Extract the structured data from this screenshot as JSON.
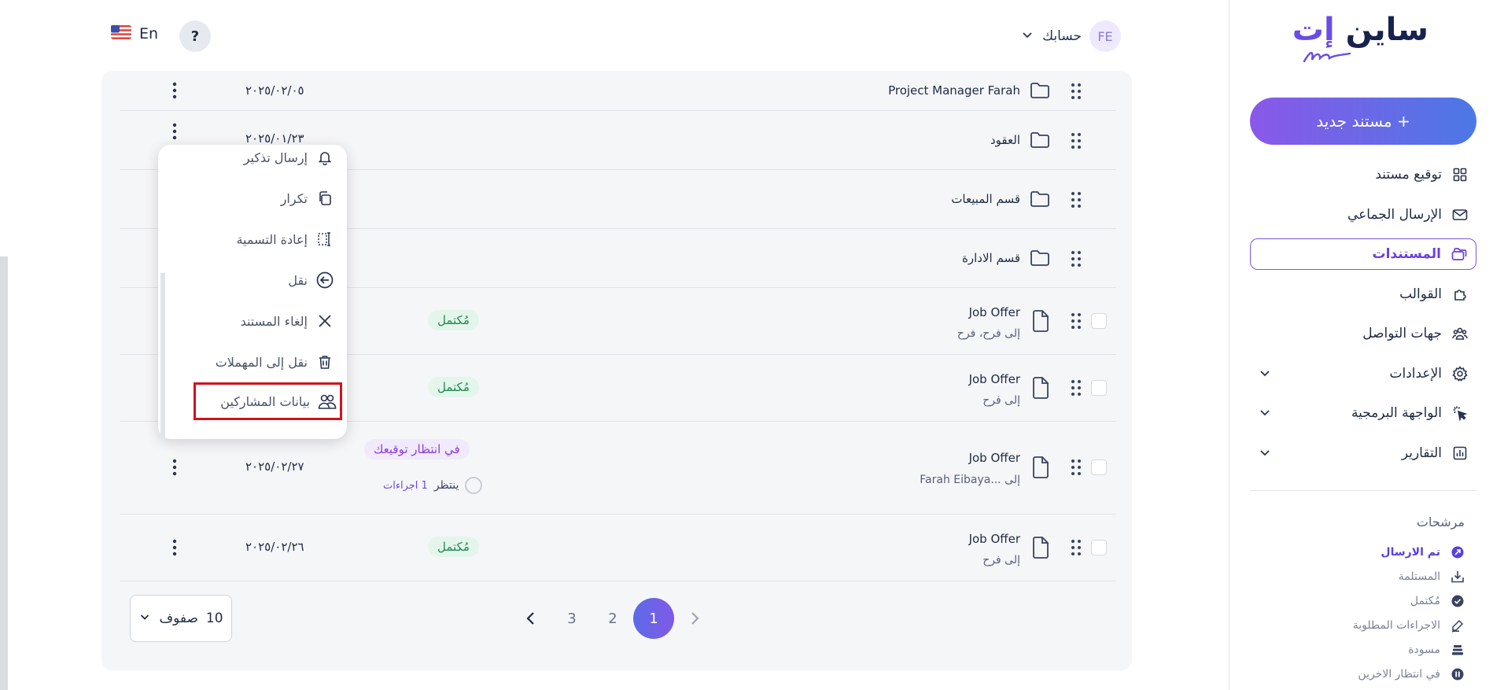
{
  "brand": {
    "logo_text_main": "ساين",
    "logo_text_accent": "إت"
  },
  "sidebar": {
    "new_document_label": "+ مستند جديد",
    "nav": [
      {
        "label": "توقيع مستند",
        "icon": "grid-icon"
      },
      {
        "label": "الإرسال الجماعي",
        "icon": "mail-icon"
      },
      {
        "label": "المستندات",
        "icon": "folders-icon",
        "active": true
      },
      {
        "label": "القوالب",
        "icon": "puzzle-icon"
      },
      {
        "label": "جهات التواصل",
        "icon": "contacts-icon"
      },
      {
        "label": "الإعدادات",
        "icon": "gear-icon",
        "expandable": true
      },
      {
        "label": "الواجهة البرمجية",
        "icon": "cursor-click-icon",
        "expandable": true
      },
      {
        "label": "التقارير",
        "icon": "chart-icon",
        "expandable": true
      }
    ],
    "filters_title": "مرشحات",
    "filters": [
      {
        "label": "تم الارسال",
        "active": true
      },
      {
        "label": "المستلمة"
      },
      {
        "label": "مُكتمل"
      },
      {
        "label": "الاجراءات المطلوبة"
      },
      {
        "label": "مسودة"
      },
      {
        "label": "في انتظار الاخرين"
      }
    ]
  },
  "header": {
    "avatar_initials": "FE",
    "account_label": "حسابك",
    "help_label": "?",
    "language_label": "En"
  },
  "rows": [
    {
      "kind": "folder",
      "name": "Project Manager Farah",
      "date": "٢٠٢٥/٠٢/٠٥"
    },
    {
      "kind": "folder",
      "name": "العقود",
      "date": "٢٠٢٥/٠١/٢٣"
    },
    {
      "kind": "folder",
      "name": "قسم المبيعات"
    },
    {
      "kind": "folder",
      "name": "قسم الادارة"
    },
    {
      "kind": "document",
      "name": "Job Offer",
      "to_prefix": "إلى",
      "to": "فرح، فرح",
      "status": "مُكتمل"
    },
    {
      "kind": "document",
      "name": "Job Offer",
      "to_prefix": "إلى",
      "to": "فرح",
      "status": "مُكتمل"
    },
    {
      "kind": "document",
      "name": "Job Offer",
      "to_prefix": "إلى",
      "to": "...Farah Eibaya",
      "status": "في انتظار توقيعك",
      "date": "٢٠٢٥/٠٢/٢٧",
      "pending_label": "ينتظر",
      "pending_count": "1 اجراءات"
    },
    {
      "kind": "document",
      "name": "Job Offer",
      "to_prefix": "إلى",
      "to": "فرح",
      "status": "مُكتمل",
      "date": "٢٠٢٥/٠٢/٢٦"
    }
  ],
  "context_menu": [
    {
      "label": "إرسال تذكير",
      "icon": "bell-icon"
    },
    {
      "label": "تكرار",
      "icon": "copy-icon"
    },
    {
      "label": "إعادة التسمية",
      "icon": "rename-icon"
    },
    {
      "label": "نقل",
      "icon": "move-arrow-icon"
    },
    {
      "label": "إلغاء المستند",
      "icon": "x-icon"
    },
    {
      "label": "نقل إلى المهملات",
      "icon": "trash-icon"
    },
    {
      "label": "بيانات المشاركين",
      "icon": "participants-icon",
      "highlighted": true
    }
  ],
  "pagination": {
    "rows_count": "10",
    "rows_label": "صفوف",
    "pages": [
      "1",
      "2",
      "3"
    ],
    "current": "1"
  },
  "colors": {
    "accent": "#6b4be6",
    "highlight_border": "#d0121d",
    "status_done_bg": "#e4f6ec",
    "status_wait_bg": "#f1eafd"
  }
}
